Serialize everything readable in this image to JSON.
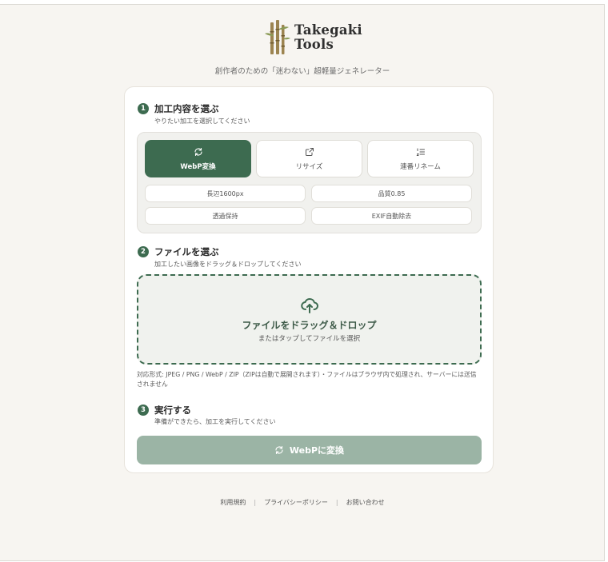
{
  "brand": {
    "line1": "Takegaki",
    "line2": "Tools",
    "accent": "#3d6b50",
    "logo_icon": "bamboo-icon"
  },
  "tagline": "創作者のための「迷わない」超軽量ジェネレーター",
  "steps": [
    {
      "num": "1",
      "title": "加工内容を選ぶ",
      "subtitle": "やりたい加工を選択してください"
    },
    {
      "num": "2",
      "title": "ファイルを選ぶ",
      "subtitle": "加工したい画像をドラッグ＆ドロップしてください"
    },
    {
      "num": "3",
      "title": "実行する",
      "subtitle": "準備ができたら、加工を実行してください"
    }
  ],
  "modes": [
    {
      "label": "WebP変換",
      "icon": "refresh-icon",
      "selected": true
    },
    {
      "label": "リサイズ",
      "icon": "resize-icon",
      "selected": false
    },
    {
      "label": "連番リネーム",
      "icon": "numbered-list-icon",
      "selected": false
    }
  ],
  "options": [
    "長辺1600px",
    "品質0.85",
    "透過保持",
    "EXIF自動除去"
  ],
  "dropzone": {
    "title": "ファイルをドラッグ＆ドロップ",
    "subtitle": "またはタップしてファイルを選択",
    "icon": "cloud-upload-icon"
  },
  "formats_note": "対応形式: JPEG / PNG / WebP / ZIP（ZIPは自動で展開されます）・ファイルはブラウザ内で処理され、サーバーには送信されません",
  "run_button": {
    "label": "WebPに変換",
    "icon": "refresh-icon",
    "color": "#9bb4a5"
  },
  "footer": {
    "terms": "利用規約",
    "privacy": "プライバシーポリシー",
    "contact": "お問い合わせ",
    "separator": "|"
  }
}
